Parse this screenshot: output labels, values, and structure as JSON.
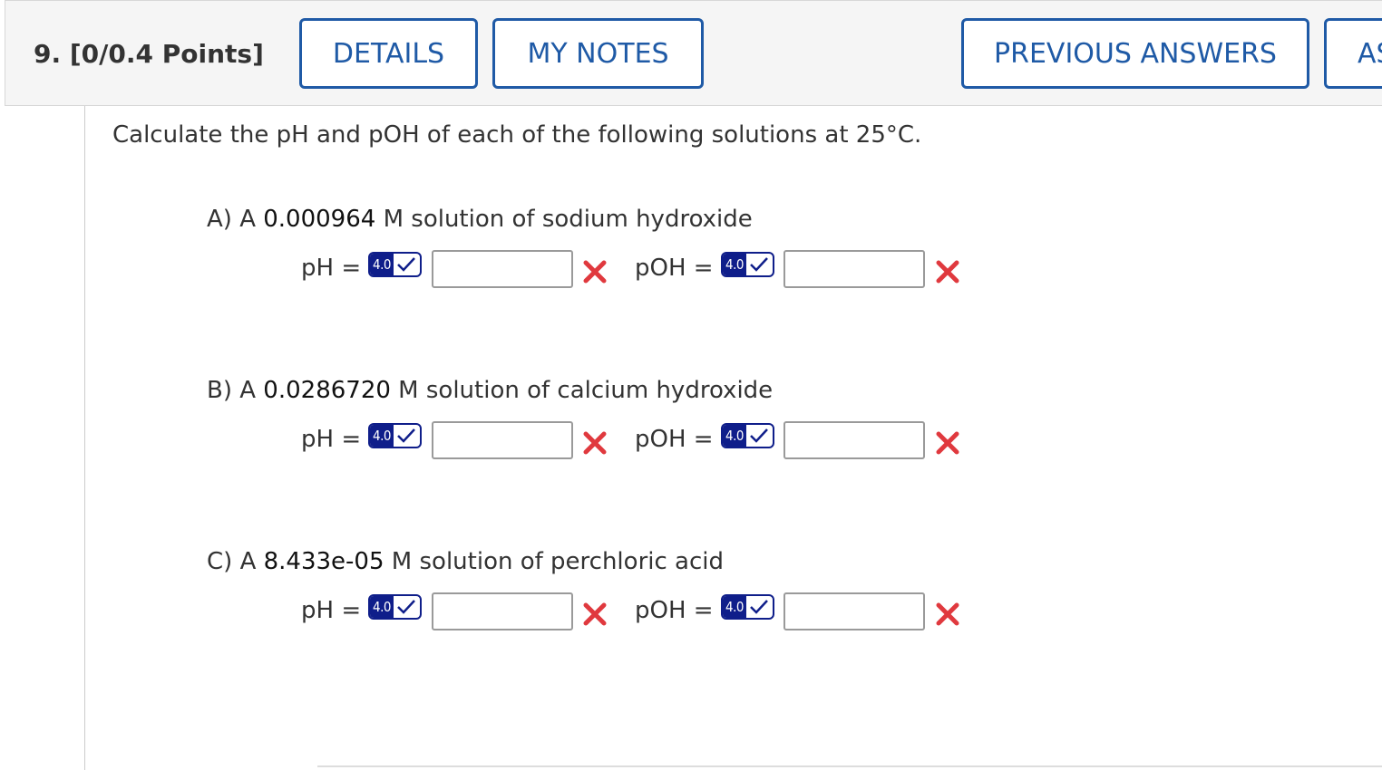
{
  "header": {
    "question_label": "9. [0/0.4 Points]",
    "details_label": "DETAILS",
    "notes_label": "MY NOTES",
    "previous_label": "PREVIOUS ANSWERS",
    "ask_label": "AS"
  },
  "question_text": "Calculate the pH and pOH of each of the following solutions at 25°C.",
  "parts": [
    {
      "prefix": "A) A",
      "value": "0.000964",
      "suffix": "M solution of sodium hydroxide",
      "ph_label": "pH =",
      "poh_label": "pOH =",
      "ph_sigfig": "4.0",
      "poh_sigfig": "4.0",
      "ph_value": "",
      "poh_value": ""
    },
    {
      "prefix": "B) A",
      "value": "0.0286720",
      "suffix": "M solution of calcium hydroxide",
      "ph_label": "pH =",
      "poh_label": "pOH =",
      "ph_sigfig": "4.0",
      "poh_sigfig": "4.0",
      "ph_value": "",
      "poh_value": ""
    },
    {
      "prefix": "C) A",
      "value": "8.433e-05",
      "suffix": "M solution of perchloric acid",
      "ph_label": "pH =",
      "poh_label": "pOH =",
      "ph_sigfig": "4.0",
      "poh_sigfig": "4.0",
      "ph_value": "",
      "poh_value": ""
    }
  ],
  "icons": {
    "sigfig_check": "check-icon",
    "incorrect": "x-mark-icon"
  },
  "colors": {
    "button_blue": "#1f5aa6",
    "sigfig_navy": "#0f1e8a",
    "incorrect_red": "#e0393e"
  }
}
